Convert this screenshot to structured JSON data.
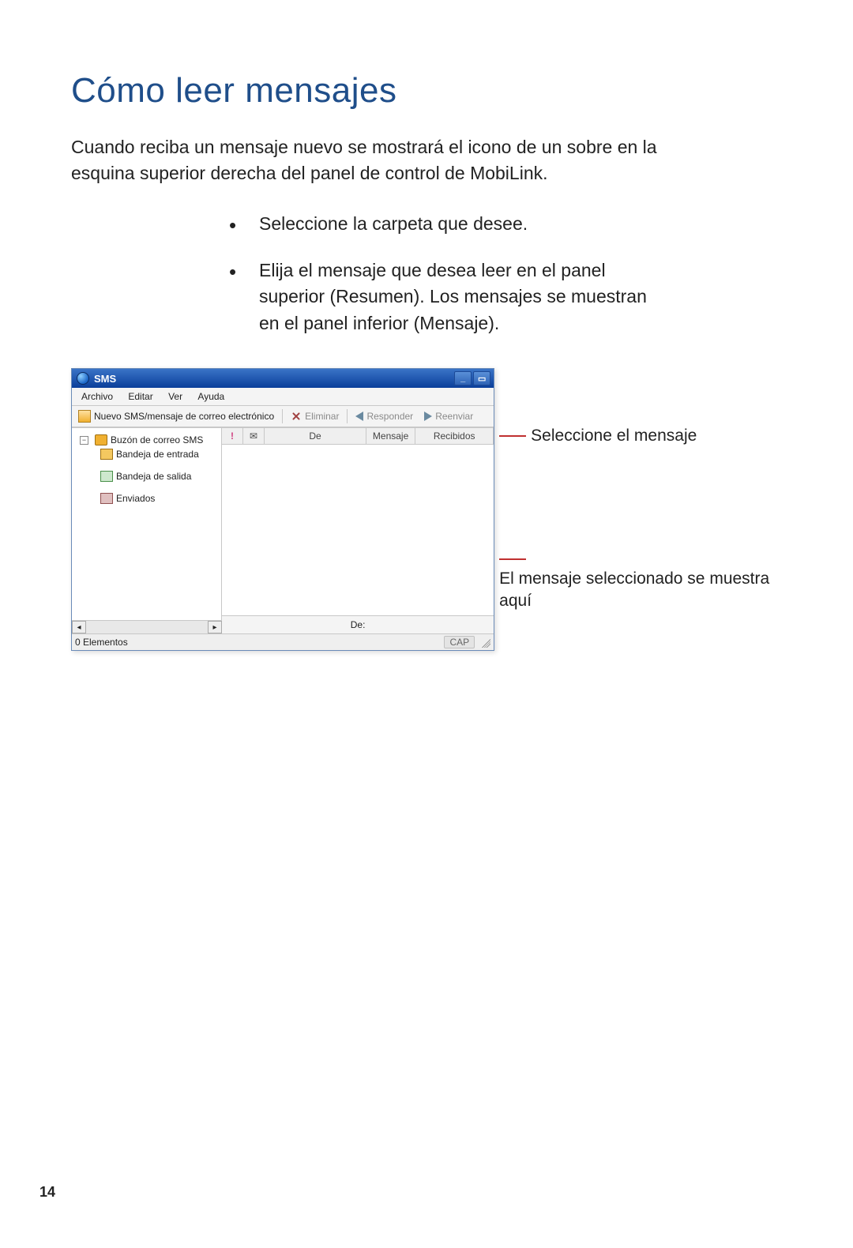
{
  "page": {
    "title": "Cómo leer mensajes",
    "intro": "Cuando reciba un mensaje nuevo se mostrará el icono de un sobre en la esquina superior derecha del panel de control de MobiLink.",
    "bullets": [
      "Seleccione la carpeta que desee.",
      "Elija el mensaje que desea leer en el panel superior (Resumen). Los mensajes se muestran en el panel inferior (Mensaje)."
    ],
    "number": "14"
  },
  "window": {
    "title": "SMS",
    "menus": {
      "file": "Archivo",
      "edit": "Editar",
      "view": "Ver",
      "help": "Ayuda"
    },
    "toolbar": {
      "new": "Nuevo SMS/mensaje de correo electrónico",
      "delete": "Eliminar",
      "reply": "Responder",
      "forward": "Reenviar"
    },
    "tree": {
      "root": "Buzón de correo SMS",
      "inbox": "Bandeja de entrada",
      "outbox": "Bandeja de salida",
      "sent": "Enviados"
    },
    "columns": {
      "from": "De",
      "message": "Mensaje",
      "received": "Recibidos"
    },
    "preview_from_label": "De:",
    "status": {
      "items": "0 Elementos",
      "cap": "CAP"
    },
    "controls": {
      "minimize": "_",
      "restore": "▭"
    }
  },
  "callouts": {
    "select": "Seleccione el mensaje",
    "shows": "El mensaje seleccionado se muestra aquí"
  }
}
